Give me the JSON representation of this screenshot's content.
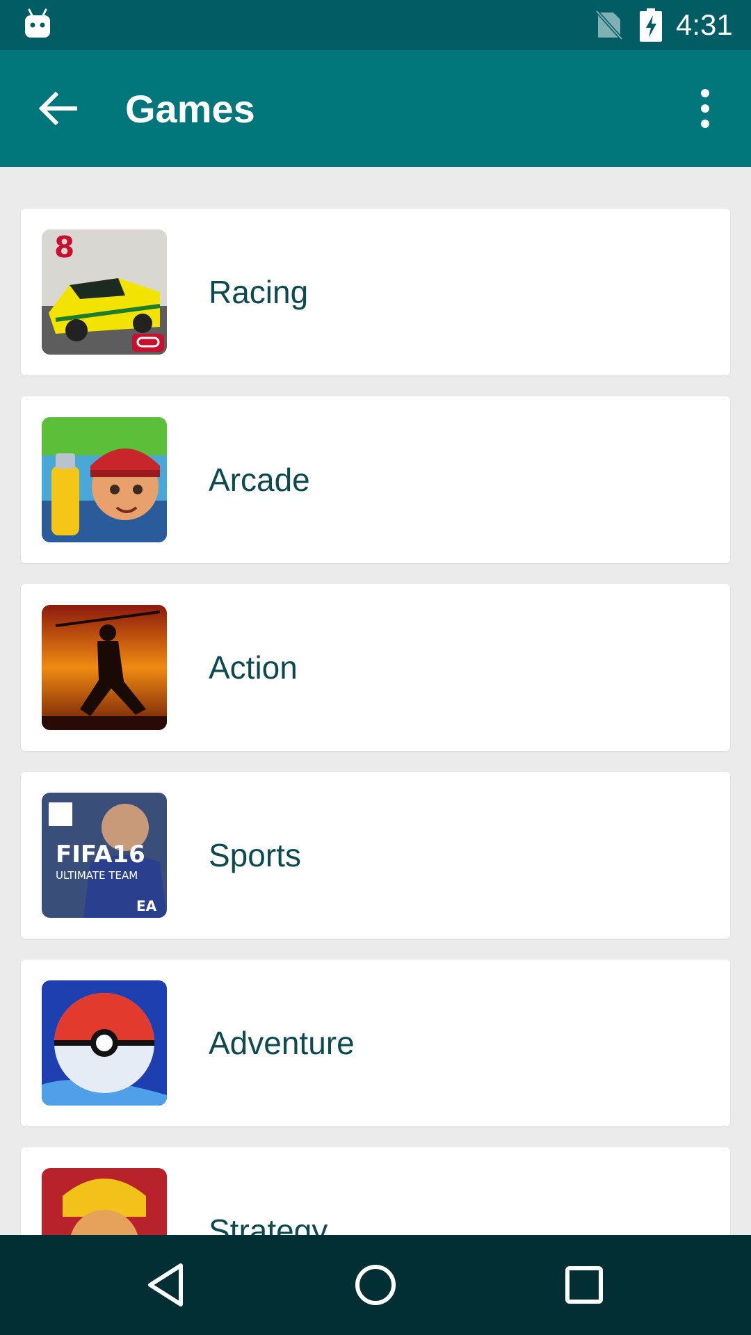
{
  "status_bar": {
    "time": "4:31",
    "icons": [
      "android-notification-icon",
      "no-sim-icon",
      "battery-charging-icon"
    ]
  },
  "app_bar": {
    "title": "Games",
    "back_icon": "arrow-back-icon",
    "menu_icon": "more-vert-icon"
  },
  "categories": [
    {
      "label": "Racing",
      "icon": "racing-thumbnail"
    },
    {
      "label": "Arcade",
      "icon": "arcade-thumbnail"
    },
    {
      "label": "Action",
      "icon": "action-thumbnail"
    },
    {
      "label": "Sports",
      "icon": "sports-thumbnail"
    },
    {
      "label": "Adventure",
      "icon": "adventure-thumbnail"
    },
    {
      "label": "Strategy",
      "icon": "strategy-thumbnail"
    }
  ],
  "thumbnail_text": {
    "racing_badge": "8",
    "sports_title": "FIFA16",
    "sports_subtitle": "ULTIMATE TEAM",
    "sports_brand": "EA"
  },
  "nav_bar": {
    "icons": [
      "nav-back-icon",
      "nav-home-icon",
      "nav-recents-icon"
    ]
  },
  "colors": {
    "status_bar": "#015c63",
    "app_bar": "#02777b",
    "background": "#ebebeb",
    "label_text": "#0d4a4f",
    "nav_bar": "#012f33"
  }
}
